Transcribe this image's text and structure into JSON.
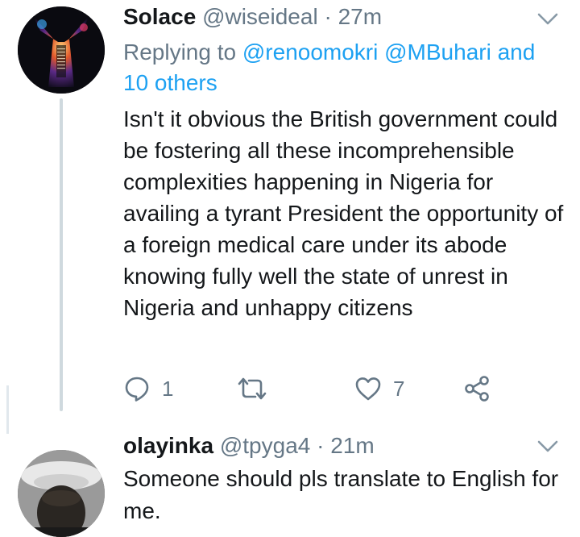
{
  "tweets": [
    {
      "display_name": "Solace",
      "handle": "@wiseideal",
      "separator": " · ",
      "time": "27m",
      "replying_prefix": "Replying to ",
      "mentions": "@renoomokri @MBuhari and 10 others",
      "text": "Isn't it obvious the British government could be fostering all these incomprehensible complexities happening in Nigeria for availing a tyrant President the opportunity of a foreign medical care under its abode knowing fully well the state of unrest in Nigeria and unhappy citizens",
      "reply_count": "1",
      "like_count": "7"
    },
    {
      "display_name": "olayinka",
      "handle": "@tpyga4",
      "separator": " · ",
      "time": "21m",
      "text": "Someone should pls translate to English for me."
    }
  ],
  "colors": {
    "text": "#14171a",
    "secondary": "#657786",
    "link": "#1da1f2",
    "thread_line": "#cfd9de"
  },
  "icons": {
    "reply": "reply-bubble-icon",
    "retweet": "retweet-arrows-icon",
    "like": "heart-icon",
    "share": "share-nodes-icon",
    "caret": "chevron-down-icon"
  }
}
